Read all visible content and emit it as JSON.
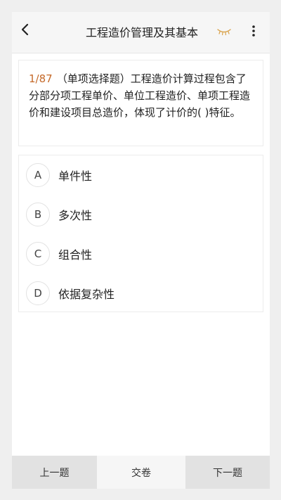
{
  "header": {
    "title": "工程造价管理及其基本"
  },
  "question": {
    "index": "1/87",
    "text": "（单项选择题）工程造价计算过程包含了分部分项工程单价、单位工程造价、单项工程造价和建设项目总造价，体现了计价的( )特征。"
  },
  "options": [
    {
      "letter": "A",
      "text": "单件性"
    },
    {
      "letter": "B",
      "text": "多次性"
    },
    {
      "letter": "C",
      "text": "组合性"
    },
    {
      "letter": "D",
      "text": "依据复杂性"
    }
  ],
  "footer": {
    "prev_label": "上一题",
    "submit_label": "交卷",
    "next_label": "下一题"
  },
  "colors": {
    "accent": "#c56a2a",
    "eye_icon": "#d9a24a"
  }
}
